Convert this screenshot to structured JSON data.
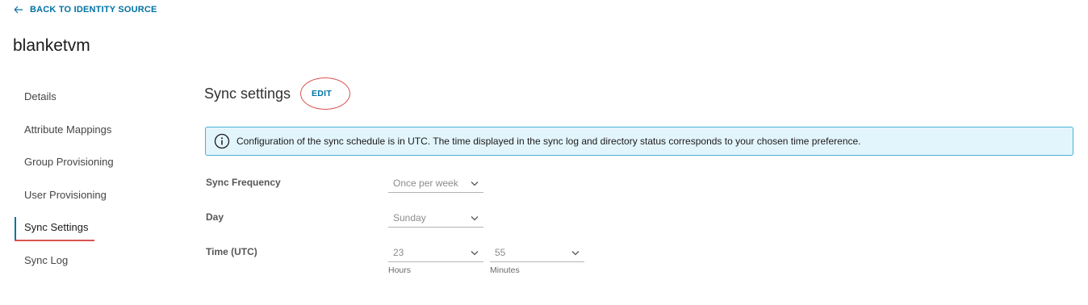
{
  "nav": {
    "back_label": "BACK TO IDENTITY SOURCE"
  },
  "page": {
    "title": "blanketvm"
  },
  "sidebar": {
    "items": [
      {
        "label": "Details"
      },
      {
        "label": "Attribute Mappings"
      },
      {
        "label": "Group Provisioning"
      },
      {
        "label": "User Provisioning"
      },
      {
        "label": "Sync Settings"
      },
      {
        "label": "Sync Log"
      }
    ],
    "active": "Sync Settings"
  },
  "section": {
    "title": "Sync settings",
    "edit_label": "EDIT"
  },
  "alert": {
    "text": "Configuration of the sync schedule is in UTC. The time displayed in the sync log and directory status corresponds to your chosen time preference.",
    "icon": "info-icon"
  },
  "form": {
    "sync_frequency": {
      "label": "Sync Frequency",
      "value": "Once per week"
    },
    "day": {
      "label": "Day",
      "value": "Sunday"
    },
    "time": {
      "label": "Time (UTC)",
      "hours_value": "23",
      "hours_hint": "Hours",
      "minutes_value": "55",
      "minutes_hint": "Minutes"
    }
  },
  "colors": {
    "link": "#0072a3",
    "annotation": "#d9534f",
    "alert_bg": "#e3f5fc",
    "alert_border": "#49afd9"
  }
}
